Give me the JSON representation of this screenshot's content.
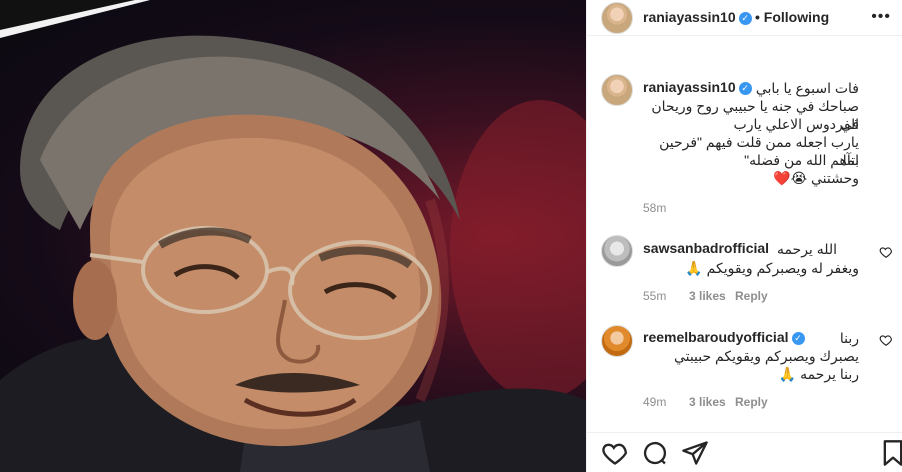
{
  "post": {
    "username": "raniayassin10",
    "verified_icon": "verified-badge-icon",
    "separator": "•",
    "follow_status": "Following",
    "more_icon": "more-options-icon"
  },
  "caption": {
    "username": "raniayassin10",
    "text_lines": [
      "فات اسبوع يا بابي",
      "صباحك في جنه يا حبيبي روح وريحان في",
      "الفردوس الاعلي يارب",
      "يارب اجعله ممن قلت فيهم \"فرحين بما",
      "اتآهم الله من فضله\"",
      "وحشتني 😭❤️"
    ],
    "time": "58m"
  },
  "comments": [
    {
      "username": "sawsanbadrofficial",
      "verified": false,
      "text_lines": [
        "الله يرحمه",
        "ويغفر له ويصبركم ويقويكم 🙏"
      ],
      "time": "55m",
      "likes": "3 likes",
      "reply": "Reply"
    },
    {
      "username": "reemelbaroudyofficial",
      "verified": true,
      "text_lines": [
        "ربنا",
        "يصبرك ويصبركم ويقويكم حبيبتي",
        "ربنا يرحمه 🙏"
      ],
      "time": "49m",
      "likes": "3 likes",
      "reply": "Reply"
    }
  ],
  "actions": {
    "like_icon": "heart-icon",
    "comment_icon": "comment-icon",
    "share_icon": "share-icon",
    "save_icon": "bookmark-icon"
  },
  "colors": {
    "verified": "#3897f0",
    "muted": "#8e8e8e",
    "text": "#262626"
  }
}
